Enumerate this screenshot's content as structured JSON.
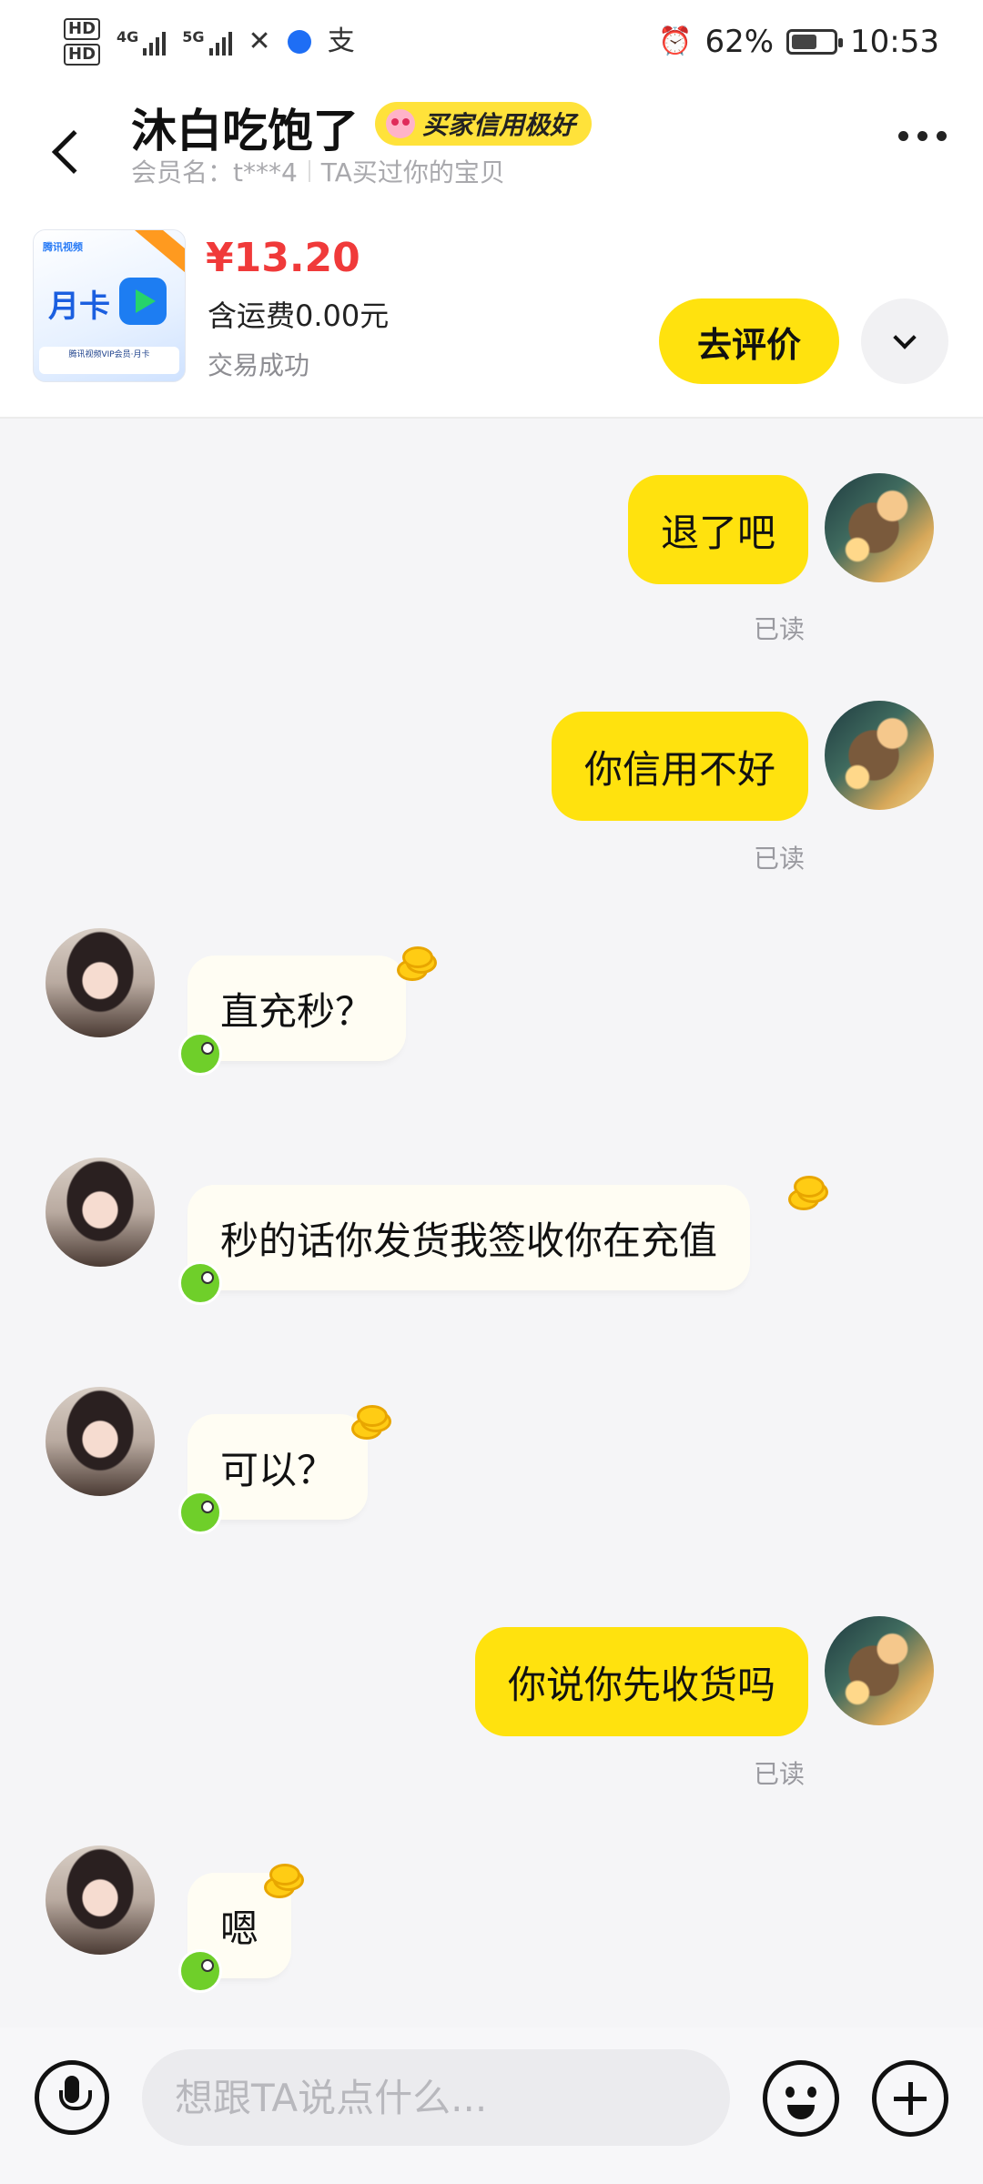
{
  "status_bar": {
    "network_left": "4G",
    "network_right": "5G",
    "battery": "62%",
    "battery_level": 0.62,
    "time": "10:53",
    "hd1": "HD",
    "hd2": "HD",
    "alipay_glyph": "支"
  },
  "header": {
    "nickname": "沐白吃饱了",
    "credit_badge": "买家信用极好",
    "member_label": "会员名：t***4",
    "bought_label": "TA买过你的宝贝"
  },
  "product": {
    "price": "¥13.20",
    "shipping": "含运费0.00元",
    "status": "交易成功",
    "review_button": "去评价",
    "thumb_card_text": "月卡",
    "thumb_brand": "腾讯视频",
    "thumb_caption": "腾讯视频VIP会员·月卡"
  },
  "chat": {
    "read_label": "已读",
    "messages": [
      {
        "side": "out",
        "text": "退了吧",
        "read": true
      },
      {
        "side": "out",
        "text": "你信用不好",
        "read": true
      },
      {
        "side": "in",
        "text": "直充秒？"
      },
      {
        "side": "in",
        "text": "秒的话你发货我签收你在充值"
      },
      {
        "side": "in",
        "text": "可以？"
      },
      {
        "side": "out",
        "text": "你说你先收货吗",
        "read": true
      },
      {
        "side": "in",
        "text": "嗯"
      }
    ]
  },
  "input": {
    "placeholder": "想跟TA说点什么..."
  },
  "colors": {
    "accent_yellow": "#ffe20e",
    "price_red": "#f03a3a"
  },
  "icons": [
    "back-icon",
    "more-icon",
    "chevron-down-icon",
    "mic-icon",
    "emoji-icon",
    "plus-icon",
    "coin-icon",
    "fish-icon",
    "alarm-icon"
  ]
}
